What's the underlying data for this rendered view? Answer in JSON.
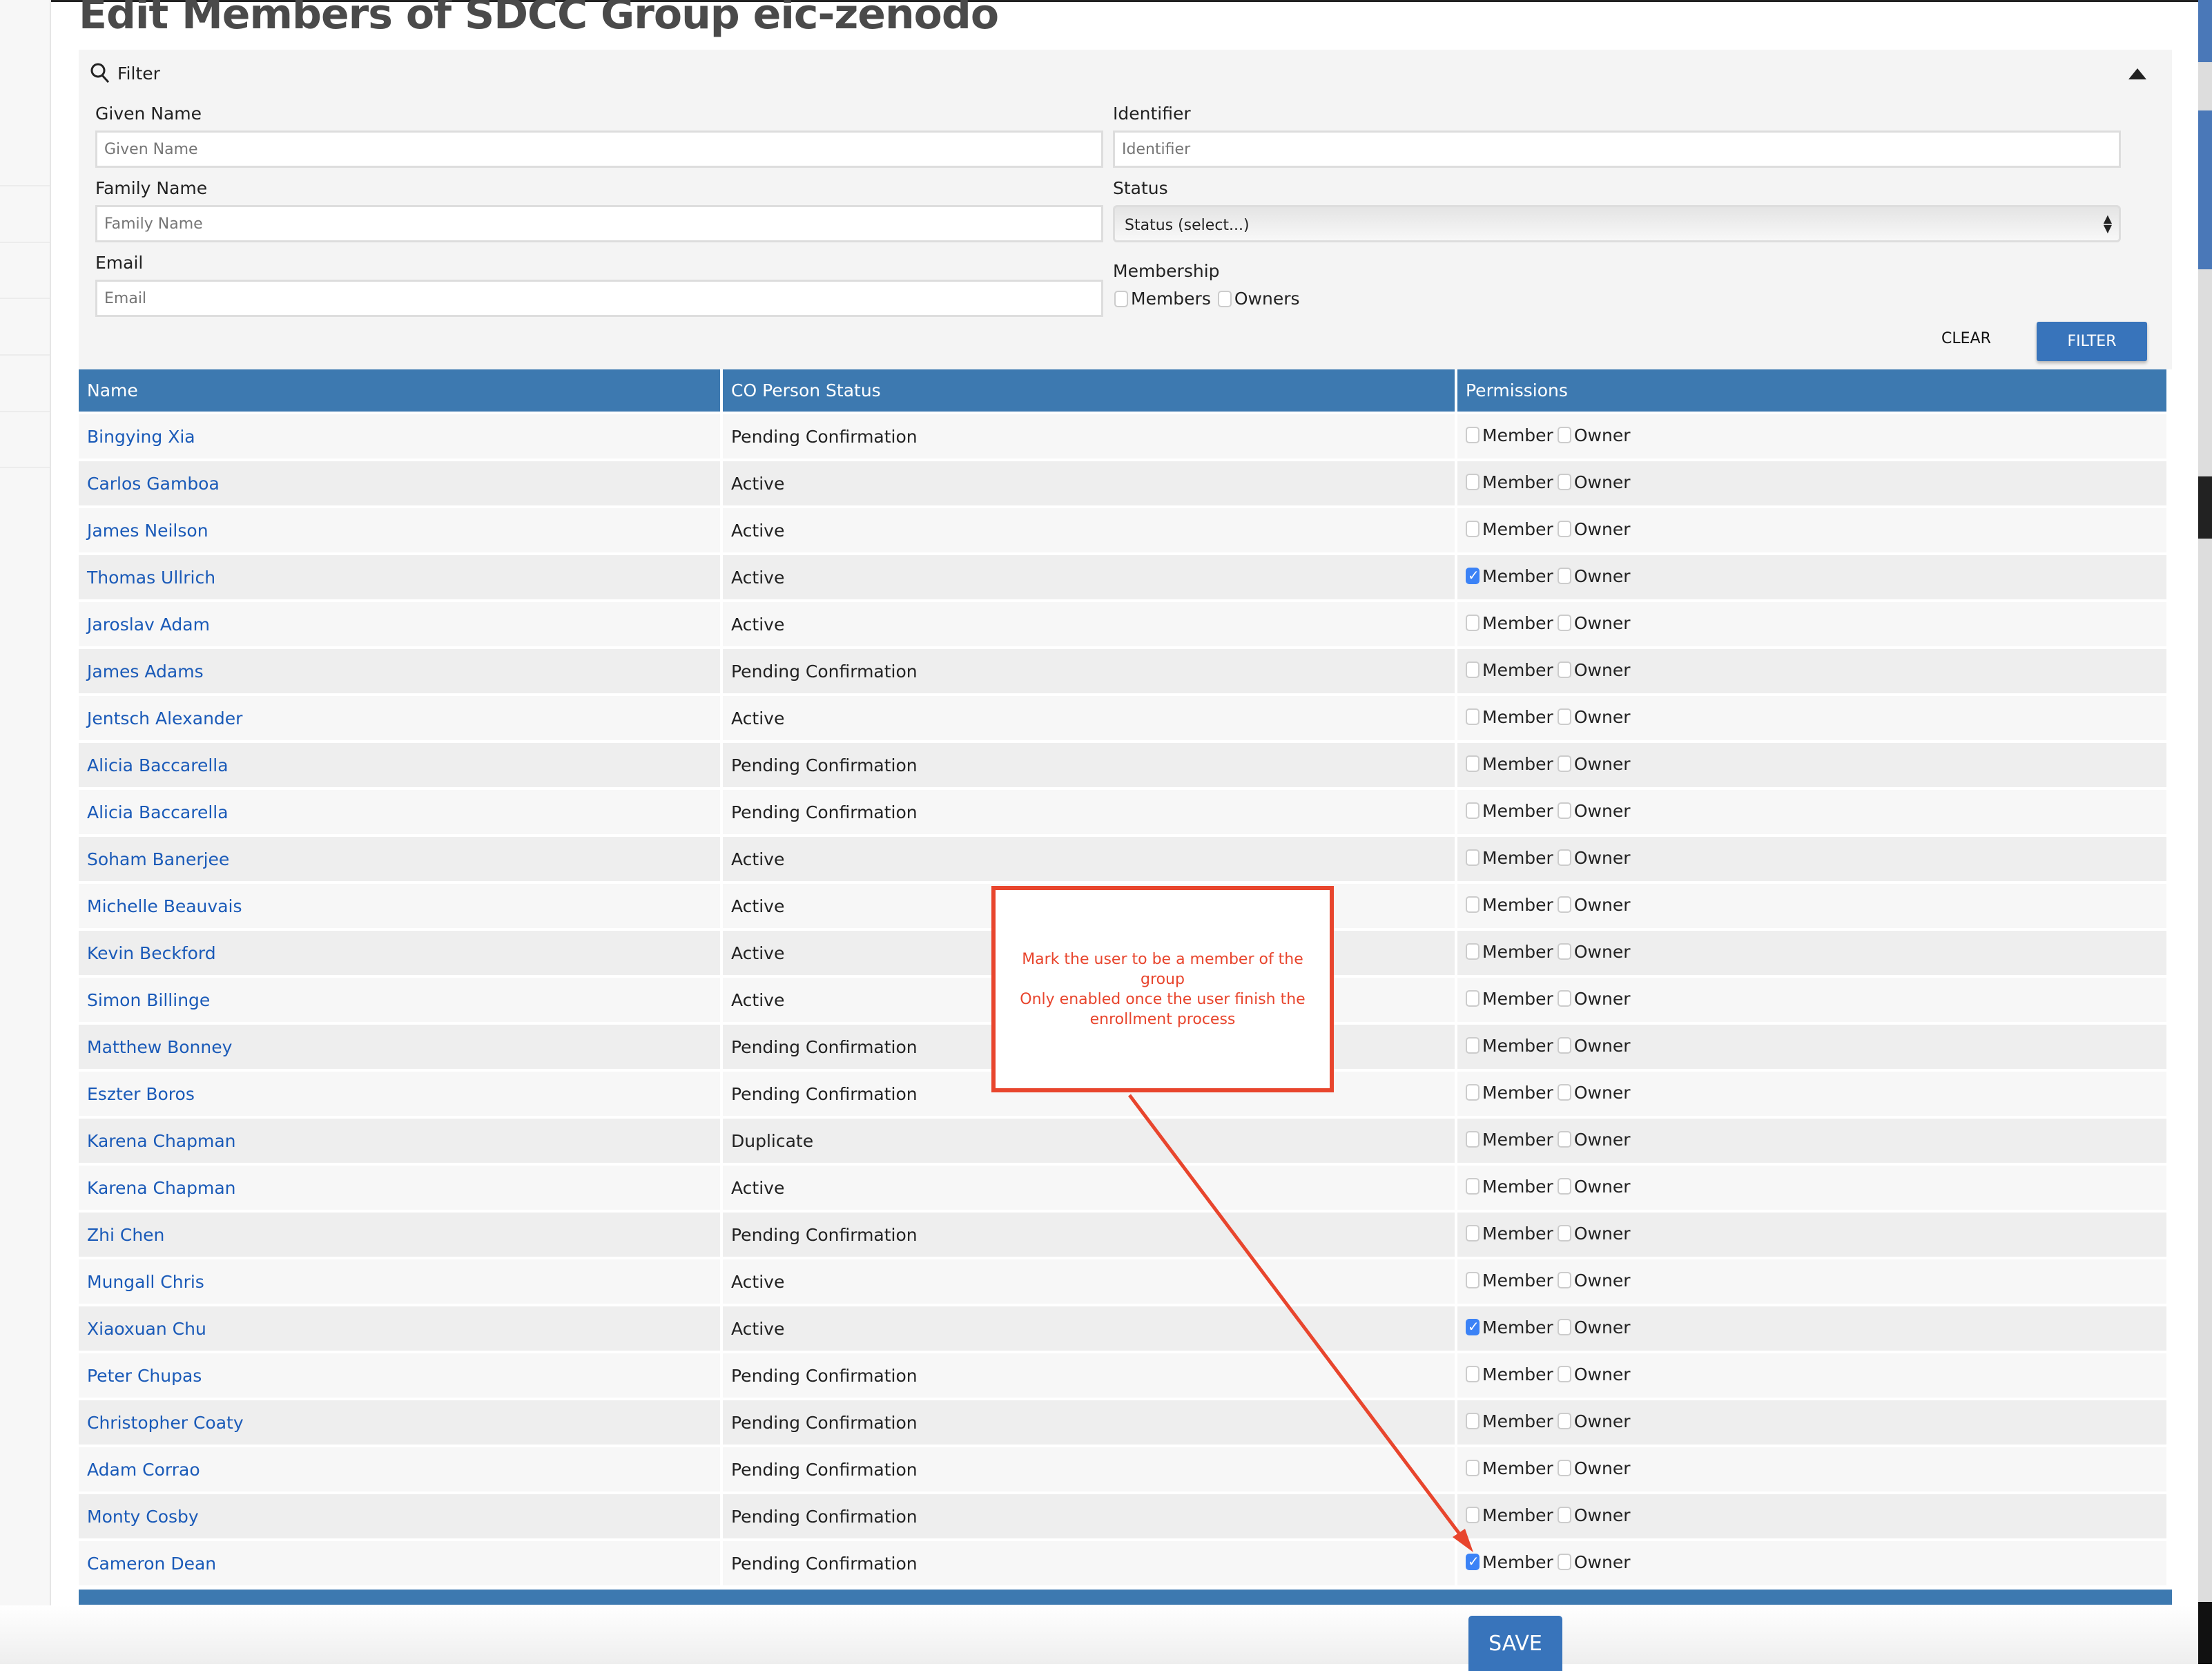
{
  "page": {
    "title": "Edit Members of SDCC Group eic-zenodo"
  },
  "filter": {
    "label": "Filter",
    "given_name": {
      "label": "Given Name",
      "placeholder": "Given Name"
    },
    "family_name": {
      "label": "Family Name",
      "placeholder": "Family Name"
    },
    "email": {
      "label": "Email",
      "placeholder": "Email"
    },
    "identifier": {
      "label": "Identifier",
      "placeholder": "Identifier"
    },
    "status": {
      "label": "Status",
      "value": "Status (select...)"
    },
    "membership": {
      "label": "Membership",
      "members": "Members",
      "owners": "Owners"
    },
    "clear_label": "CLEAR",
    "filter_label": "FILTER"
  },
  "table": {
    "columns": [
      "Name",
      "CO Person Status",
      "Permissions"
    ],
    "member_label": "Member",
    "owner_label": "Owner",
    "rows": [
      {
        "name": "Bingying Xia",
        "status": "Pending Confirmation",
        "member": false,
        "owner": false
      },
      {
        "name": "Carlos Gamboa",
        "status": "Active",
        "member": false,
        "owner": false
      },
      {
        "name": "James Neilson",
        "status": "Active",
        "member": false,
        "owner": false
      },
      {
        "name": "Thomas Ullrich",
        "status": "Active",
        "member": true,
        "owner": false
      },
      {
        "name": "Jaroslav Adam",
        "status": "Active",
        "member": false,
        "owner": false
      },
      {
        "name": "James Adams",
        "status": "Pending Confirmation",
        "member": false,
        "owner": false
      },
      {
        "name": "Jentsch Alexander",
        "status": "Active",
        "member": false,
        "owner": false
      },
      {
        "name": "Alicia Baccarella",
        "status": "Pending Confirmation",
        "member": false,
        "owner": false
      },
      {
        "name": "Alicia Baccarella",
        "status": "Pending Confirmation",
        "member": false,
        "owner": false
      },
      {
        "name": "Soham Banerjee",
        "status": "Active",
        "member": false,
        "owner": false
      },
      {
        "name": "Michelle Beauvais",
        "status": "Active",
        "member": false,
        "owner": false
      },
      {
        "name": "Kevin Beckford",
        "status": "Active",
        "member": false,
        "owner": false
      },
      {
        "name": "Simon Billinge",
        "status": "Active",
        "member": false,
        "owner": false
      },
      {
        "name": "Matthew Bonney",
        "status": "Pending Confirmation",
        "member": false,
        "owner": false
      },
      {
        "name": "Eszter Boros",
        "status": "Pending Confirmation",
        "member": false,
        "owner": false
      },
      {
        "name": "Karena Chapman",
        "status": "Duplicate",
        "member": false,
        "owner": false
      },
      {
        "name": "Karena Chapman",
        "status": "Active",
        "member": false,
        "owner": false
      },
      {
        "name": "Zhi Chen",
        "status": "Pending Confirmation",
        "member": false,
        "owner": false
      },
      {
        "name": "Mungall Chris",
        "status": "Active",
        "member": false,
        "owner": false
      },
      {
        "name": "Xiaoxuan Chu",
        "status": "Active",
        "member": true,
        "owner": false
      },
      {
        "name": "Peter Chupas",
        "status": "Pending Confirmation",
        "member": false,
        "owner": false
      },
      {
        "name": "Christopher Coaty",
        "status": "Pending Confirmation",
        "member": false,
        "owner": false
      },
      {
        "name": "Adam Corrao",
        "status": "Pending Confirmation",
        "member": false,
        "owner": false
      },
      {
        "name": "Monty Cosby",
        "status": "Pending Confirmation",
        "member": false,
        "owner": false
      },
      {
        "name": "Cameron Dean",
        "status": "Pending Confirmation",
        "member": true,
        "owner": false
      }
    ]
  },
  "save_label": "SAVE",
  "annotation": {
    "lines": [
      "Mark the user to be a member of the group",
      "Only enabled once the user finish the",
      "enrollment process"
    ],
    "color": "#e8452d"
  },
  "colors": {
    "header": "#3d79b0",
    "button": "#3874bb",
    "link": "#1a5ab8",
    "checked": "#3b82f6"
  }
}
